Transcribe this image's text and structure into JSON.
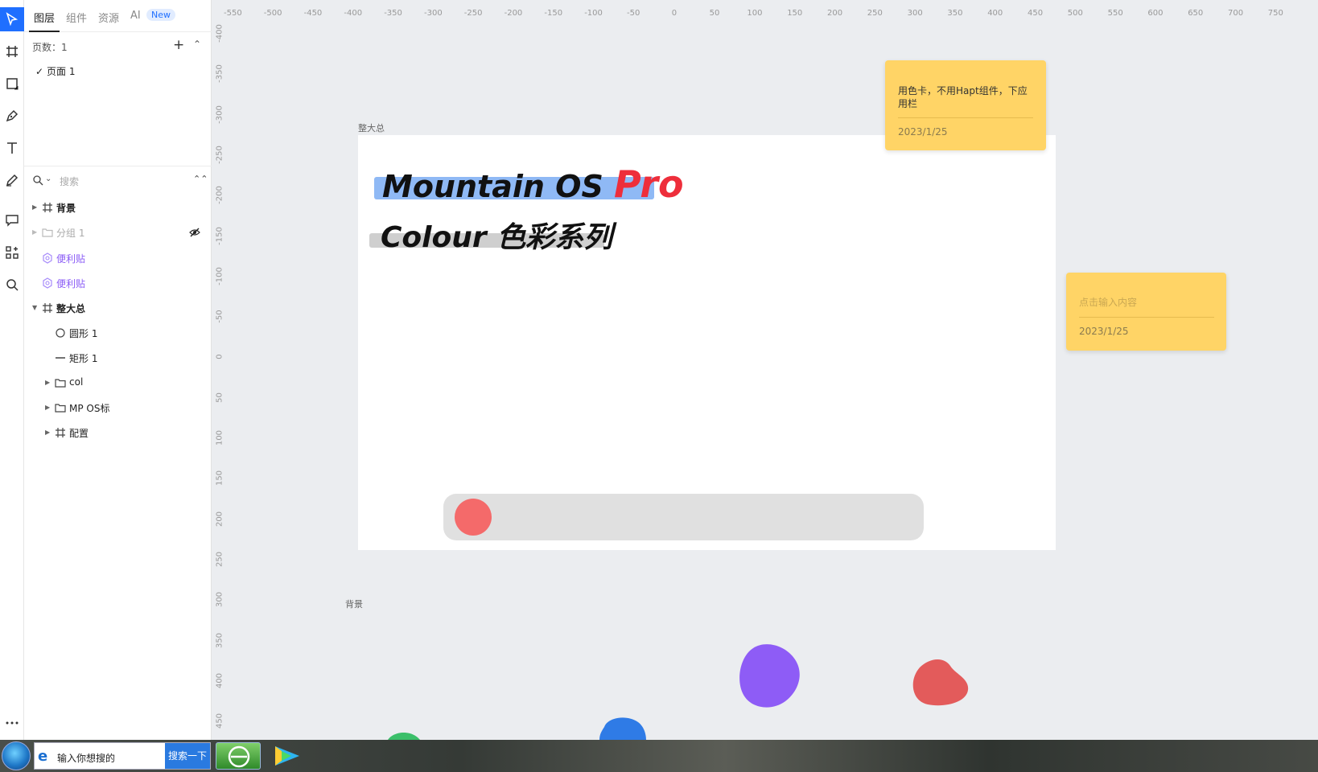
{
  "panel": {
    "tabs": [
      {
        "label": "图层"
      },
      {
        "label": "组件"
      },
      {
        "label": "资源"
      },
      {
        "label": "AI"
      }
    ],
    "new_badge": "New",
    "pages_label": "页数：1",
    "pages": [
      {
        "label": "页面 1"
      }
    ],
    "search_placeholder": "搜索",
    "layers": [
      {
        "label": "背景"
      },
      {
        "label": "分组 1"
      },
      {
        "label": "便利贴"
      },
      {
        "label": "便利贴"
      },
      {
        "label": "整大总"
      },
      {
        "label": "圆形 1"
      },
      {
        "label": "矩形 1"
      },
      {
        "label": "col"
      },
      {
        "label": "MP OS标"
      },
      {
        "label": "配置"
      }
    ]
  },
  "canvas": {
    "ruler_x": [
      "-550",
      "-500",
      "-450",
      "-400",
      "-350",
      "-300",
      "-250",
      "-200",
      "-150",
      "-100",
      "-50",
      "0",
      "50",
      "100",
      "150",
      "200",
      "250",
      "300",
      "350",
      "400",
      "450",
      "500",
      "550",
      "600",
      "650",
      "700",
      "750"
    ],
    "ruler_y": [
      "-400",
      "-350",
      "-300",
      "-250",
      "-200",
      "-150",
      "-100",
      "-50",
      "0",
      "50",
      "100",
      "150",
      "200",
      "250",
      "300",
      "350",
      "400",
      "450"
    ],
    "frame_label": "整大总",
    "bg_label": "背景",
    "title_main": "Mountain OS ",
    "title_pro": "Pro",
    "title_sub": "Colour 色彩系列",
    "slider_value_fraction": 0.0,
    "colors": {
      "accent": "#1f6fff",
      "pro": "#ee2e3b",
      "highlight_blue": "#8fb9f5",
      "note": "#ffd466",
      "knob": "#f46a6a",
      "blob_purple": "#8e5cf6",
      "blob_red": "#e35b5b",
      "blob_blue": "#2f7be6",
      "blob_green": "#3bbf6a"
    },
    "notes": [
      {
        "text": "用色卡，不用Hapt组件，下应用栏",
        "date": "2023/1/25"
      },
      {
        "text": "点击输入内容",
        "date": "2023/1/25"
      }
    ]
  },
  "taskbar": {
    "search_text": "输入你想搜的",
    "search_button": "搜索一下"
  }
}
